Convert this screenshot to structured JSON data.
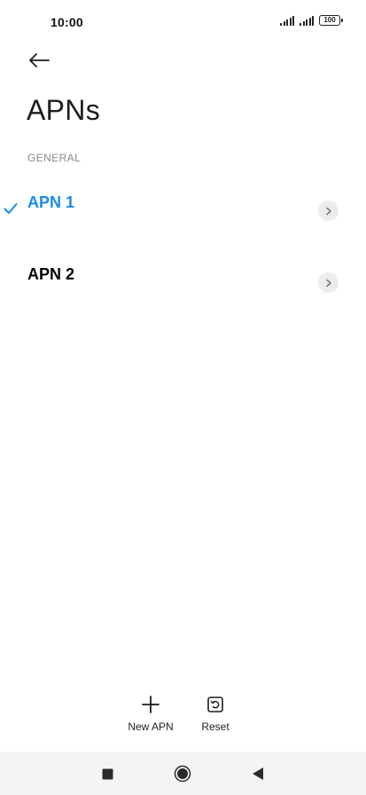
{
  "status_bar": {
    "time": "10:00",
    "battery": "100"
  },
  "header": {
    "back_icon": "arrow-left-icon",
    "title": "APNs"
  },
  "section": {
    "label": "GENERAL"
  },
  "apns": [
    {
      "label": "APN 1",
      "selected": true
    },
    {
      "label": "APN 2",
      "selected": false
    }
  ],
  "actions": {
    "new_apn": {
      "label": "New APN",
      "icon": "plus-icon"
    },
    "reset": {
      "label": "Reset",
      "icon": "reset-icon"
    }
  },
  "colors": {
    "accent": "#1a8be6",
    "nav_bar": "#f4f4f4"
  }
}
